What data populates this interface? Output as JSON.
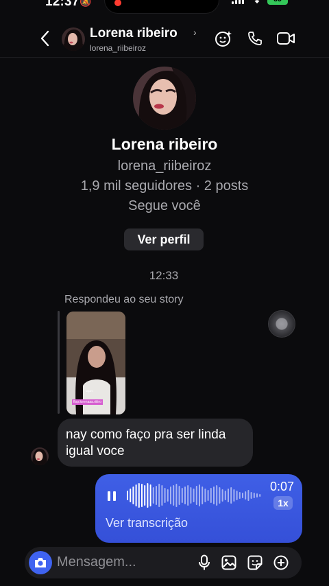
{
  "status_bar": {
    "time": "12:37",
    "battery": "69"
  },
  "header": {
    "name": "Lorena ribeiro",
    "username": "lorena_riibeiroz"
  },
  "profile": {
    "name": "Lorena ribeiro",
    "username": "lorena_riibeiroz",
    "stats": "1,9 mil seguidores · 2 posts",
    "follows_you": "Segue você",
    "view_profile_label": "Ver perfil"
  },
  "thread": {
    "timestamp": "12:33",
    "story_reply_label": "Respondeu ao seu story",
    "story_overlay_text": "flop.lorenaaa.riiiiro",
    "story_overlay_text2": "sigam",
    "incoming_message": "nay como faço pra ser linda igual voce",
    "voice_message": {
      "duration": "0:07",
      "speed": "1x",
      "transcript_link": "Ver transcrição"
    }
  },
  "composer": {
    "placeholder": "Mensagem..."
  },
  "colors": {
    "accent": "#3f63f0",
    "bubble_out": "#3b5bdb",
    "bubble_in": "#26262a",
    "background": "#0b0b0d"
  }
}
